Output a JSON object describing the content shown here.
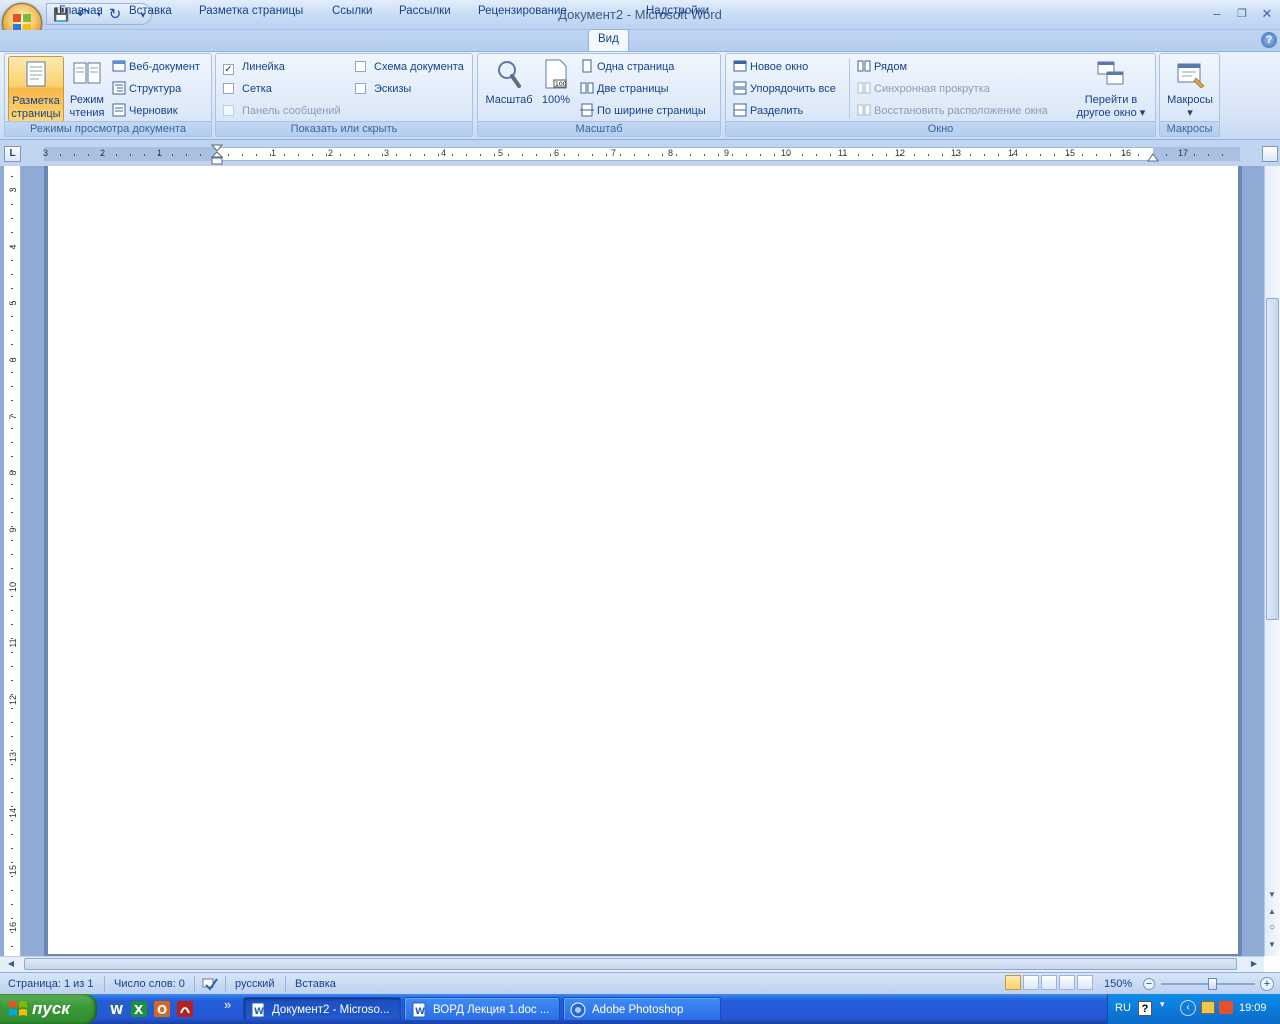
{
  "window": {
    "title": "Документ2 - Microsoft Word",
    "min_label": "–",
    "max_label": "❐",
    "close_label": "✕"
  },
  "qat": {
    "save": "💾",
    "undo": "↶",
    "redo": "↻",
    "more": "▾"
  },
  "tabs": [
    {
      "label": "Главная"
    },
    {
      "label": "Вставка"
    },
    {
      "label": "Разметка страницы"
    },
    {
      "label": "Ссылки"
    },
    {
      "label": "Рассылки"
    },
    {
      "label": "Рецензирование"
    },
    {
      "label": "Вид",
      "active": true
    },
    {
      "label": "Надстройки"
    }
  ],
  "help": "?",
  "ribbon": {
    "view_modes": {
      "label": "Режимы просмотра документа",
      "page_layout": "Разметка\nстраницы",
      "reading": "Режим\nчтения",
      "web": "Веб-документ",
      "outline": "Структура",
      "draft": "Черновик"
    },
    "show_hide": {
      "label": "Показать или скрыть",
      "ruler": "Линейка",
      "ruler_checked": true,
      "grid": "Сетка",
      "message_bar": "Панель сообщений",
      "doc_map": "Схема документа",
      "thumbnails": "Эскизы"
    },
    "zoom": {
      "label": "Масштаб",
      "zoom": "Масштаб",
      "hundred": "100%",
      "one_page": "Одна страница",
      "two_pages": "Две страницы",
      "page_width": "По ширине страницы"
    },
    "window": {
      "label": "Окно",
      "new_window": "Новое окно",
      "arrange_all": "Упорядочить все",
      "split": "Разделить",
      "side_by_side": "Рядом",
      "sync_scroll": "Синхронная прокрутка",
      "reset_pos": "Восстановить расположение окна",
      "switch": "Перейти в\nдругое окно ▾"
    },
    "macros": {
      "label": "Макросы",
      "button": "Макросы\n▾"
    }
  },
  "ruler": {
    "corner": "L",
    "h_marks": [
      "3",
      "2",
      "1",
      "1",
      "2",
      "3",
      "4",
      "5",
      "6",
      "7",
      "8",
      "9",
      "10",
      "11",
      "12",
      "13",
      "14",
      "15",
      "16",
      "17"
    ],
    "v_marks": [
      "3",
      "4",
      "5",
      "6",
      "7",
      "8",
      "9",
      "10",
      "11",
      "12",
      "13",
      "14",
      "15",
      "16"
    ]
  },
  "status": {
    "page": "Страница: 1 из 1",
    "words": "Число слов: 0",
    "lang": "русский",
    "mode": "Вставка",
    "zoom": "150%",
    "zoom_out": "−",
    "zoom_in": "+"
  },
  "taskbar": {
    "start": "пуск",
    "more": "»",
    "items": [
      {
        "label": "Документ2 - Microso...",
        "active": true
      },
      {
        "label": "ВОРД Лекция 1.doc ...",
        "active": false
      },
      {
        "label": "Adobe Photoshop",
        "active": false
      }
    ],
    "tray": {
      "lang": "RU",
      "time": "19:09"
    }
  },
  "colors": {
    "accent": "#15428b",
    "ribbon": "#dce8f8",
    "taskbar": "#245edb",
    "start": "#3c9a39"
  }
}
